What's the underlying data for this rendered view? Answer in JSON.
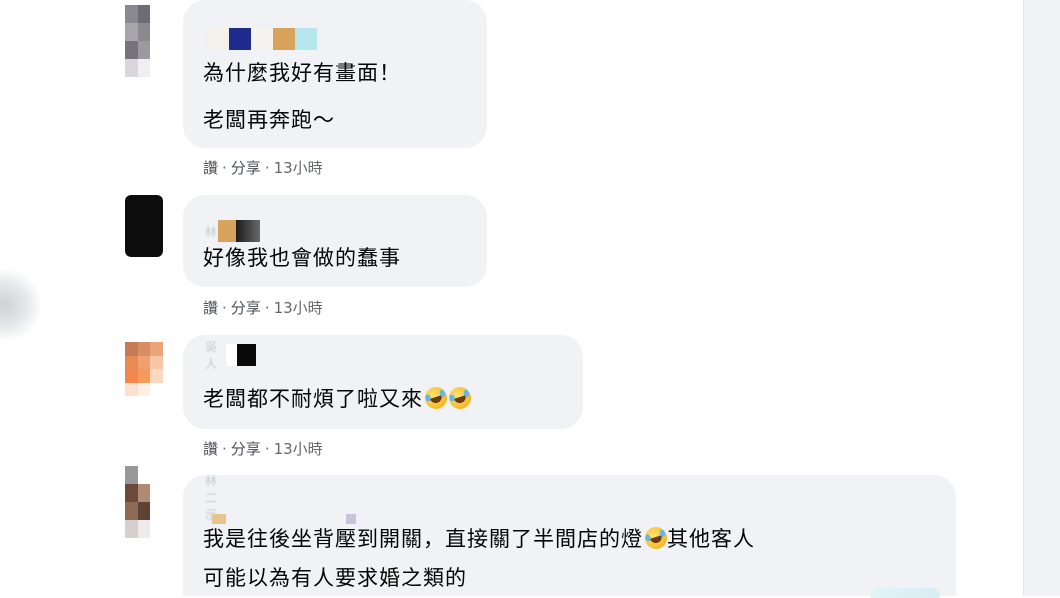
{
  "comments": [
    {
      "lines": [
        "為什麼我好有畫面！",
        "老闆再奔跑～"
      ],
      "actions": {
        "like": "讚",
        "share": "分享",
        "time": "13小時"
      }
    },
    {
      "lines": [
        "好像我也會做的蠢事"
      ],
      "actions": {
        "like": "讚",
        "share": "分享",
        "time": "13小時"
      }
    },
    {
      "lines": [
        "老闆都不耐煩了啦又來"
      ],
      "emoji_after_line": [
        "face-with-tears-of-joy-icon",
        "face-with-tears-of-joy-icon"
      ],
      "actions": {
        "like": "讚",
        "share": "分享",
        "time": "13小時"
      }
    },
    {
      "lines": [
        "我是往後坐背壓到開關，直接關了半間店的燈",
        "其他客人",
        "可能以為有人要求婚之類的"
      ]
    }
  ],
  "separator": "·",
  "colors": {
    "bubble": "#f0f2f5",
    "text": "#050505",
    "meta": "#65676b"
  }
}
